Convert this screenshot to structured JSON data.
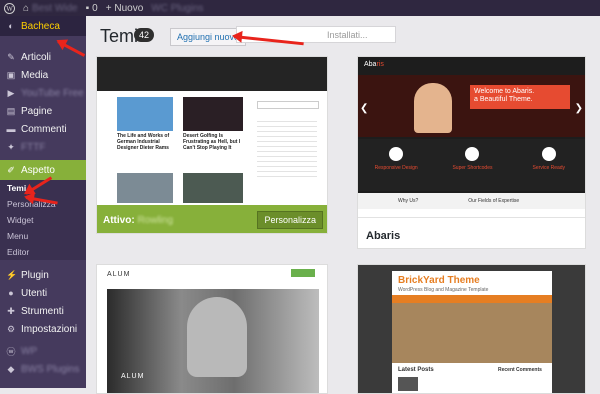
{
  "topbar": {
    "wp_logo": "wordpress-icon",
    "site_name": "Best Wide",
    "comments_count": "0",
    "new_label": "+ Nuovo",
    "plugins_label": "WC Plugins"
  },
  "sidebar": {
    "items": [
      {
        "label": "Bacheca",
        "icon": "dashboard-icon"
      },
      {
        "label": "Articoli",
        "icon": "pin-icon"
      },
      {
        "label": "Media",
        "icon": "media-icon"
      },
      {
        "label": "YouTube Free",
        "icon": "video-icon"
      },
      {
        "label": "Pagine",
        "icon": "page-icon"
      },
      {
        "label": "Commenti",
        "icon": "comment-icon"
      },
      {
        "label": "FTTF",
        "icon": "star-icon"
      },
      {
        "label": "Aspetto",
        "icon": "brush-icon"
      },
      {
        "label": "Plugin",
        "icon": "plug-icon"
      },
      {
        "label": "Utenti",
        "icon": "user-icon"
      },
      {
        "label": "Strumenti",
        "icon": "wrench-icon"
      },
      {
        "label": "Impostazioni",
        "icon": "settings-icon"
      }
    ],
    "aspetto_sub": [
      "Temi",
      "Personalizza",
      "Widget",
      "Menu",
      "Editor"
    ],
    "bottom": [
      "WP",
      "BWS Plugins"
    ]
  },
  "main": {
    "title": "Temi",
    "count": "42",
    "add_new": "Aggiungi nuovo",
    "search_placeholder": "Installati...",
    "themes": [
      {
        "name": "Rowling",
        "active_label": "Attivo:",
        "action": "Personalizza",
        "posts": [
          "The Life and Works of German Industrial Designer Dieter Rams",
          "Desert Golfing Is Frustrating as Hell, but I Can't Stop Playing It"
        ]
      },
      {
        "name": "Abaris",
        "banner_title": "Welcome to Abaris.",
        "banner_sub": "a Beautiful Theme.",
        "features": [
          "Responsive Design",
          "Super Shortcodes",
          "Service Ready"
        ],
        "footer_links": [
          "Why Us?",
          "Our Fields of Expertise"
        ]
      },
      {
        "name": "Alum",
        "header": "ALUM",
        "caption": "ALUM"
      },
      {
        "name": "BrickYard Theme",
        "header": "BrickYard Theme",
        "tagline": "WordPress Blog and Magazine Template",
        "section": "Latest Posts",
        "side": "Recent Comments"
      }
    ]
  },
  "colors": {
    "admin_bg": "#453a5d",
    "accent": "#87b03a",
    "arrow": "#e8241c"
  }
}
